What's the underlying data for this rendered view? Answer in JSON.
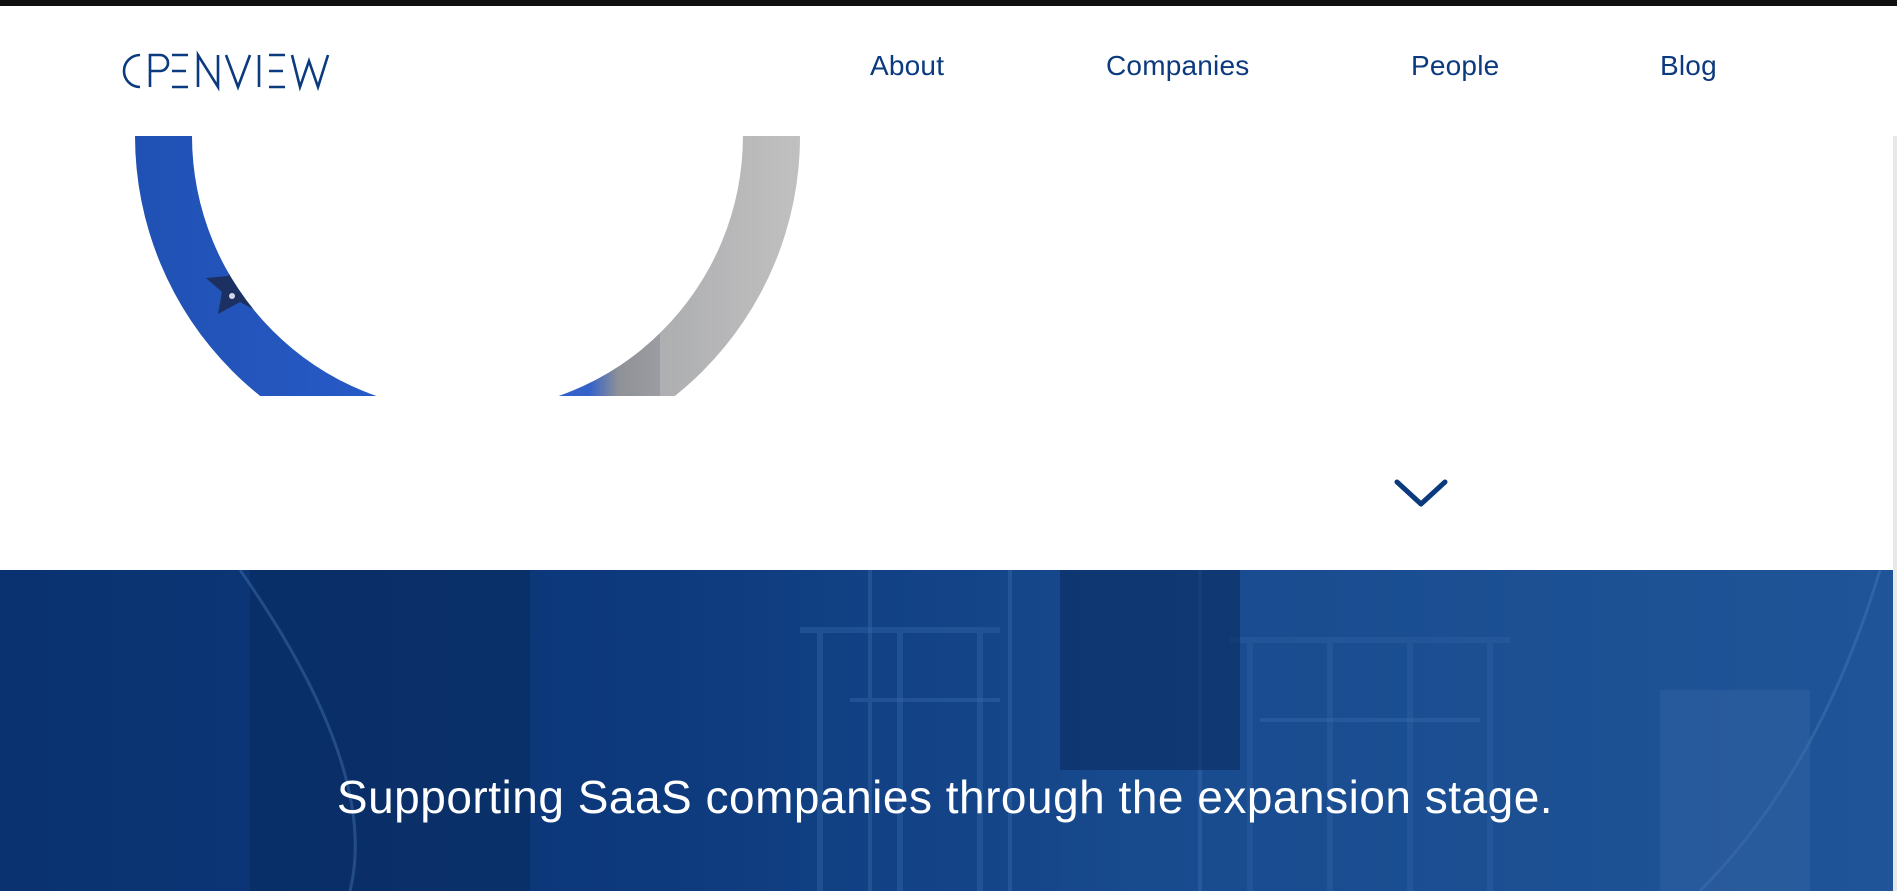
{
  "header": {
    "logo_text": "OPENVIEW",
    "nav": [
      {
        "label": "About"
      },
      {
        "label": "Companies"
      },
      {
        "label": "People"
      },
      {
        "label": "Blog"
      }
    ]
  },
  "hero": {
    "image_icon": "star-pattern-circle-photo",
    "scroll_icon": "chevron-down-icon"
  },
  "banner": {
    "headline": "Supporting SaaS companies through the expansion stage."
  },
  "colors": {
    "brand_blue": "#0b3a7e",
    "banner_blue": "#0a3a7c",
    "white": "#ffffff"
  }
}
